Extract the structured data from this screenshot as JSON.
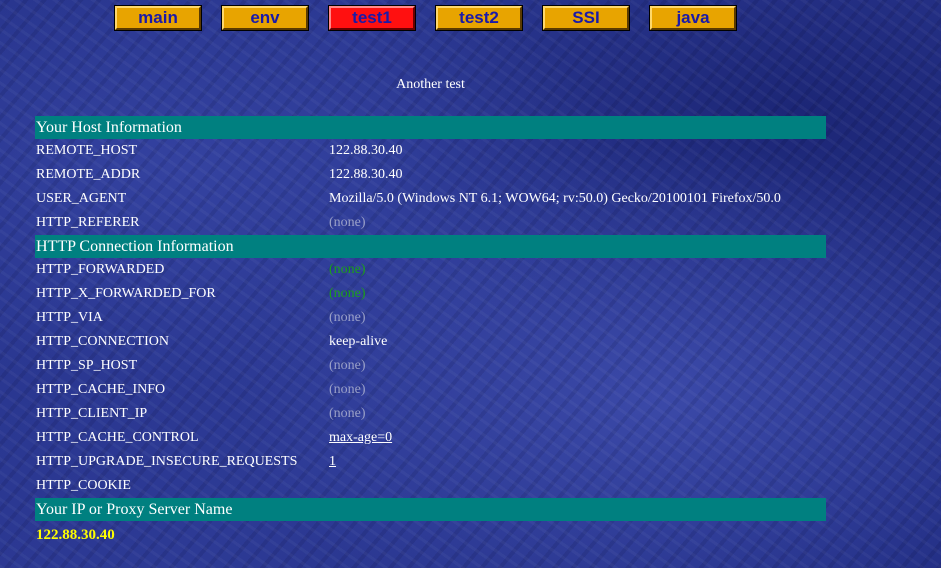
{
  "nav": {
    "items": [
      {
        "label": "main"
      },
      {
        "label": "env"
      },
      {
        "label": "test1",
        "active": true
      },
      {
        "label": "test2"
      },
      {
        "label": "SSI"
      },
      {
        "label": "java"
      }
    ]
  },
  "heading": "Another test",
  "sections": {
    "host": {
      "title": "Your Host Information",
      "rows": {
        "remote_host": {
          "name": "REMOTE_HOST",
          "value": "122.88.30.40"
        },
        "remote_addr": {
          "name": "REMOTE_ADDR",
          "value": "122.88.30.40"
        },
        "user_agent": {
          "name": "USER_AGENT",
          "value": "Mozilla/5.0 (Windows NT 6.1; WOW64; rv:50.0) Gecko/20100101 Firefox/50.0"
        },
        "http_referer": {
          "name": "HTTP_REFERER",
          "value": "(none)"
        }
      }
    },
    "connection": {
      "title": "HTTP Connection Information",
      "rows": {
        "forwarded": {
          "name": "HTTP_FORWARDED",
          "value": "(none)"
        },
        "x_forwarded_for": {
          "name": "HTTP_X_FORWARDED_FOR",
          "value": "(none)"
        },
        "via": {
          "name": "HTTP_VIA",
          "value": "(none)"
        },
        "connection": {
          "name": "HTTP_CONNECTION",
          "value": "keep-alive"
        },
        "sp_host": {
          "name": "HTTP_SP_HOST",
          "value": "(none)"
        },
        "cache_info": {
          "name": "HTTP_CACHE_INFO",
          "value": "(none)"
        },
        "client_ip": {
          "name": "HTTP_CLIENT_IP",
          "value": "(none)"
        },
        "cache_control": {
          "name": "HTTP_CACHE_CONTROL",
          "value": "max-age=0"
        },
        "upgrade_insecure": {
          "name": "HTTP_UPGRADE_INSECURE_REQUESTS",
          "value": "1"
        },
        "cookie": {
          "name": "HTTP_COOKIE",
          "value": ""
        }
      }
    },
    "proxy": {
      "title": "Your IP or Proxy Server Name",
      "ip": "122.88.30.40"
    }
  },
  "colors": {
    "background": "#25328a",
    "section_header": "#008080",
    "nav_button": "#e8a400",
    "nav_button_active": "#ff1010",
    "nav_text": "#1a1aa8",
    "none_value": "#9aa0c8",
    "green_value": "#1aa01a",
    "ip_text": "#ffff00"
  }
}
